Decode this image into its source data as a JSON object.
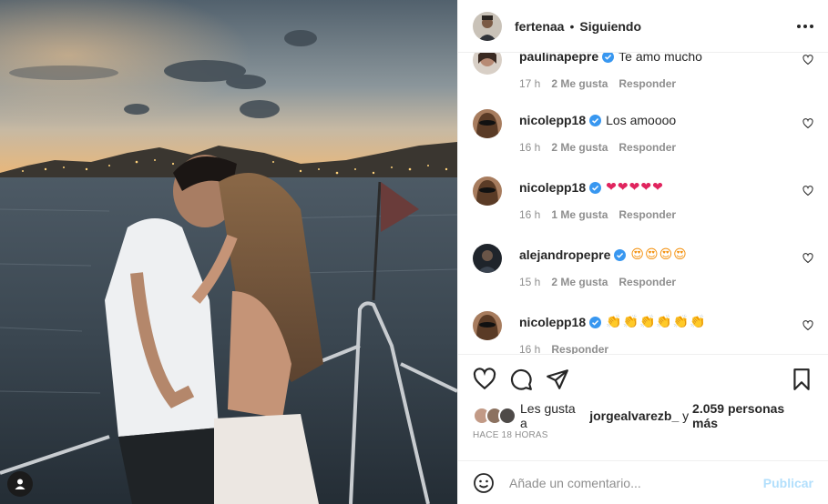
{
  "post": {
    "author": "fertenaa",
    "separator": "•",
    "follow_status": "Siguiendo"
  },
  "comments": [
    {
      "username": "paulinapepre",
      "verified": true,
      "text": "Te amo mucho",
      "time": "17 h",
      "likes": "2 Me gusta",
      "reply": "Responder",
      "partial": "top"
    },
    {
      "username": "nicolepp18",
      "verified": true,
      "text": "Los amoooo",
      "time": "16 h",
      "likes": "2 Me gusta",
      "reply": "Responder"
    },
    {
      "username": "nicolepp18",
      "verified": true,
      "text": "❤❤❤❤❤",
      "time": "16 h",
      "likes": "1 Me gusta",
      "reply": "Responder"
    },
    {
      "username": "alejandropepre",
      "verified": true,
      "text": "😍😍😍😍",
      "time": "15 h",
      "likes": "2 Me gusta",
      "reply": "Responder"
    },
    {
      "username": "nicolepp18",
      "verified": true,
      "text": "👏👏👏👏👏👏",
      "time": "16 h",
      "likes": "",
      "reply": "Responder",
      "partial": "bottom"
    }
  ],
  "likes": {
    "prefix": "Les gusta a",
    "user": "jorgealvarezb_",
    "conj": "y",
    "count": "2.059 personas más"
  },
  "timestamp": "HACE 18 HORAS",
  "add_comment": {
    "placeholder": "Añade un comentario...",
    "publish_label": "Publicar"
  },
  "icons": {
    "more": "more-options-icon",
    "like": "heart-icon",
    "comment": "comment-icon",
    "share": "share-icon",
    "save": "bookmark-icon",
    "emoji": "emoji-icon",
    "verified": "verified-badge-icon",
    "user_tag": "user-tag-icon"
  },
  "colors": {
    "verified": "#3897f0",
    "publish_disabled": "#b2dffc",
    "text": "#262626",
    "muted": "#8e8e8e"
  }
}
